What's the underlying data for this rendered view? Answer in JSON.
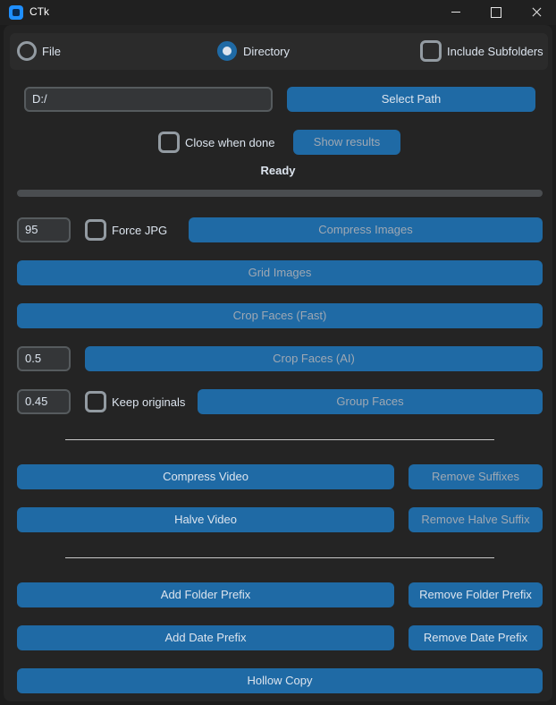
{
  "window": {
    "title": "CTk"
  },
  "mode": {
    "file_label": "File",
    "directory_label": "Directory",
    "selected": "Directory",
    "include_subfolders_label": "Include Subfolders",
    "include_subfolders_checked": false
  },
  "path": {
    "value": "D:/",
    "select_button": "Select Path"
  },
  "options": {
    "close_when_done_label": "Close when done",
    "close_when_done_checked": false,
    "show_results_button": "Show results"
  },
  "status": {
    "text": "Ready",
    "progress": 0
  },
  "compress": {
    "quality": "95",
    "force_jpg_label": "Force JPG",
    "force_jpg_checked": false,
    "button": "Compress Images"
  },
  "grid_button": "Grid Images",
  "crop_fast_button": "Crop Faces (Fast)",
  "crop_ai": {
    "value": "0.5",
    "button": "Crop Faces (AI)"
  },
  "group": {
    "value": "0.45",
    "keep_originals_label": "Keep originals",
    "keep_originals_checked": false,
    "button": "Group Faces"
  },
  "video": {
    "compress_button": "Compress Video",
    "remove_suffixes_button": "Remove Suffixes",
    "halve_button": "Halve Video",
    "remove_halve_suffix_button": "Remove Halve Suffix"
  },
  "prefix": {
    "add_folder_button": "Add Folder Prefix",
    "remove_folder_button": "Remove Folder Prefix",
    "add_date_button": "Add Date Prefix",
    "remove_date_button": "Remove Date Prefix"
  },
  "hollow_copy_button": "Hollow Copy",
  "colors": {
    "accent": "#1f6aa5",
    "background": "#242424",
    "frame": "#2b2b2b"
  }
}
